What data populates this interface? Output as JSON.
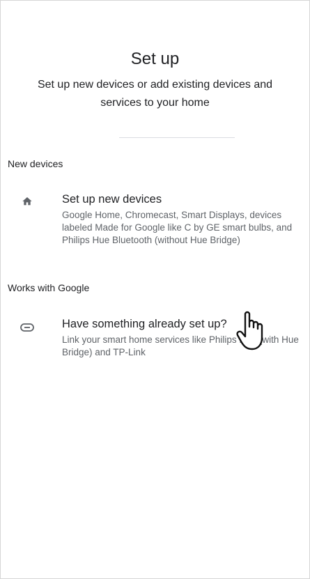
{
  "header": {
    "title": "Set up",
    "subtitle": "Set up new devices or add existing devices and services to your home"
  },
  "sections": [
    {
      "label": "New devices",
      "items": [
        {
          "icon": "home-icon",
          "title": "Set up new devices",
          "description": "Google Home, Chromecast, Smart Displays, devices labeled Made for Google like C by GE smart bulbs, and Philips Hue Bluetooth (without Hue Bridge)"
        }
      ]
    },
    {
      "label": "Works with Google",
      "items": [
        {
          "icon": "link-icon",
          "title": "Have something already set up?",
          "description": "Link your smart home services like Philips Hue (with Hue Bridge) and TP-Link"
        }
      ]
    }
  ],
  "colors": {
    "text_primary": "#202124",
    "text_secondary": "#5f6368",
    "divider": "#dadce0",
    "icon": "#5f6368"
  }
}
